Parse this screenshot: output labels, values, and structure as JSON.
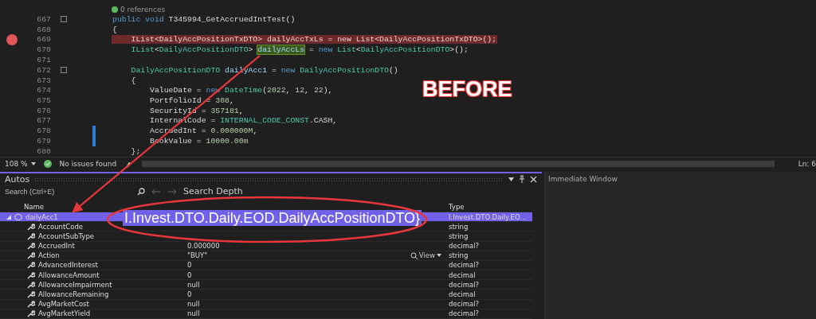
{
  "editor": {
    "codelens": "0 references",
    "lines": [
      {
        "number": "667",
        "breakpoint": false,
        "changed": false,
        "foldable": true,
        "tokens": [
          {
            "kind": "keyword",
            "text": "public"
          },
          {
            "kind": "keyword",
            "text": " void"
          },
          {
            "kind": "plain",
            "text": " T345994_GetAccruedIntTest()"
          }
        ]
      },
      {
        "number": "668",
        "breakpoint": false,
        "changed": false,
        "foldable": false,
        "tokens": [
          {
            "kind": "plain",
            "text": "{"
          }
        ]
      },
      {
        "number": "669",
        "breakpoint": true,
        "changed": false,
        "foldable": false,
        "tokens": [
          {
            "kind": "plain",
            "text": "    IList<DailyAccPositionTxDTO> dailyAccTxLs = new List<DailyAccPositionTxDTO>();"
          }
        ]
      },
      {
        "number": "670",
        "breakpoint": false,
        "changed": false,
        "foldable": false,
        "tokens": [
          {
            "kind": "type",
            "text": "    IList"
          },
          {
            "kind": "plain",
            "text": "<"
          },
          {
            "kind": "type",
            "text": "DailyAccPositionDTO"
          },
          {
            "kind": "plain",
            "text": "> "
          },
          {
            "kind": "match",
            "text": "dailyAccLs"
          },
          {
            "kind": "plain",
            "text": " = "
          },
          {
            "kind": "keyword",
            "text": "new"
          },
          {
            "kind": "type",
            "text": " List"
          },
          {
            "kind": "plain",
            "text": "<"
          },
          {
            "kind": "type",
            "text": "DailyAccPositionDTO"
          },
          {
            "kind": "plain",
            "text": ">();"
          }
        ]
      },
      {
        "number": "671",
        "breakpoint": false,
        "changed": false,
        "foldable": false
      },
      {
        "number": "672",
        "breakpoint": false,
        "changed": false,
        "foldable": true,
        "tokens": [
          {
            "kind": "type",
            "text": "    DailyAccPositionDTO"
          },
          {
            "kind": "ident",
            "text": " dailyAcc1"
          },
          {
            "kind": "plain",
            "text": " = "
          },
          {
            "kind": "keyword",
            "text": "new"
          },
          {
            "kind": "type",
            "text": " DailyAccPositionDTO"
          },
          {
            "kind": "plain",
            "text": "()"
          }
        ]
      },
      {
        "number": "673",
        "breakpoint": false,
        "changed": false,
        "foldable": false,
        "tokens": [
          {
            "kind": "plain",
            "text": "    {"
          }
        ]
      },
      {
        "number": "674",
        "breakpoint": false,
        "changed": false,
        "foldable": false,
        "tokens": [
          {
            "kind": "plain",
            "text": "        ValueDate = "
          },
          {
            "kind": "keyword",
            "text": "new"
          },
          {
            "kind": "type",
            "text": " DateTime"
          },
          {
            "kind": "plain",
            "text": "("
          },
          {
            "kind": "number",
            "text": "2022"
          },
          {
            "kind": "plain",
            "text": ", "
          },
          {
            "kind": "number",
            "text": "12"
          },
          {
            "kind": "plain",
            "text": ", "
          },
          {
            "kind": "number",
            "text": "22"
          },
          {
            "kind": "plain",
            "text": "),"
          }
        ]
      },
      {
        "number": "675",
        "breakpoint": false,
        "changed": false,
        "foldable": false,
        "tokens": [
          {
            "kind": "plain",
            "text": "        PortfolioId = "
          },
          {
            "kind": "number",
            "text": "308"
          },
          {
            "kind": "plain",
            "text": ","
          }
        ]
      },
      {
        "number": "676",
        "breakpoint": false,
        "changed": false,
        "foldable": false,
        "tokens": [
          {
            "kind": "plain",
            "text": "        SecurityId = "
          },
          {
            "kind": "number",
            "text": "357181"
          },
          {
            "kind": "plain",
            "text": ","
          }
        ]
      },
      {
        "number": "677",
        "breakpoint": false,
        "changed": false,
        "foldable": false,
        "tokens": [
          {
            "kind": "plain",
            "text": "        InternalCode = "
          },
          {
            "kind": "type",
            "text": "INTERNAL_CODE_CONST"
          },
          {
            "kind": "plain",
            "text": ".CASH,"
          }
        ]
      },
      {
        "number": "678",
        "breakpoint": false,
        "changed": true,
        "foldable": false,
        "tokens": [
          {
            "kind": "plain",
            "text": "        AccruedInt = "
          },
          {
            "kind": "number",
            "text": "0.000000M"
          },
          {
            "kind": "plain",
            "text": ","
          }
        ]
      },
      {
        "number": "679",
        "breakpoint": false,
        "changed": true,
        "foldable": false,
        "tokens": [
          {
            "kind": "plain",
            "text": "        BookValue = "
          },
          {
            "kind": "number",
            "text": "10000.00m"
          }
        ]
      },
      {
        "number": "680",
        "breakpoint": false,
        "changed": false,
        "foldable": false,
        "tokens": [
          {
            "kind": "plain",
            "text": "    };"
          }
        ]
      }
    ]
  },
  "annotation": {
    "heading": "BEFORE",
    "callout": "I.Invest.DTO.Daily.EOD.DailyAccPositionDTO}"
  },
  "status_bar": {
    "zoom": "108 %",
    "issues": "No issues found",
    "position": "Ln: 6"
  },
  "autos": {
    "title": "Autos",
    "search": {
      "placeholder": "Search (Ctrl+E)"
    },
    "search_depth_label": "Search Depth",
    "columns": {
      "name": "Name",
      "type": "Type"
    },
    "rows": [
      {
        "name": "dailyAcc1",
        "kind": "object",
        "expanded": true,
        "selected": true,
        "type": "I.Invest.DTO.Daily.EO..."
      },
      {
        "name": "AccountCode",
        "kind": "property",
        "selected": false,
        "type": "string"
      },
      {
        "name": "AccountSubType",
        "kind": "property",
        "selected": false,
        "type": "string"
      },
      {
        "name": "AccruedInt",
        "kind": "property",
        "selected": false,
        "value": "0.000000",
        "type": "decimal?"
      },
      {
        "name": "Action",
        "kind": "property",
        "selected": false,
        "value": "\"BUY\"",
        "viewer": "View",
        "type": "string"
      },
      {
        "name": "AdvancedInterest",
        "kind": "property",
        "selected": false,
        "value": "0",
        "type": "decimal?"
      },
      {
        "name": "AllowanceAmount",
        "kind": "property",
        "selected": false,
        "value": "0",
        "type": "decimal"
      },
      {
        "name": "AllowanceImpairment",
        "kind": "property",
        "selected": false,
        "value": "null",
        "type": "decimal?"
      },
      {
        "name": "AllowanceRemaining",
        "kind": "property",
        "selected": false,
        "value": "0",
        "type": "decimal"
      },
      {
        "name": "AvgMarketCost",
        "kind": "property",
        "selected": false,
        "value": "null",
        "type": "decimal?"
      },
      {
        "name": "AvgMarketYield",
        "kind": "property",
        "selected": false,
        "value": "null",
        "type": "decimal?"
      }
    ]
  },
  "immediate": {
    "title": "Immediate Window"
  }
}
